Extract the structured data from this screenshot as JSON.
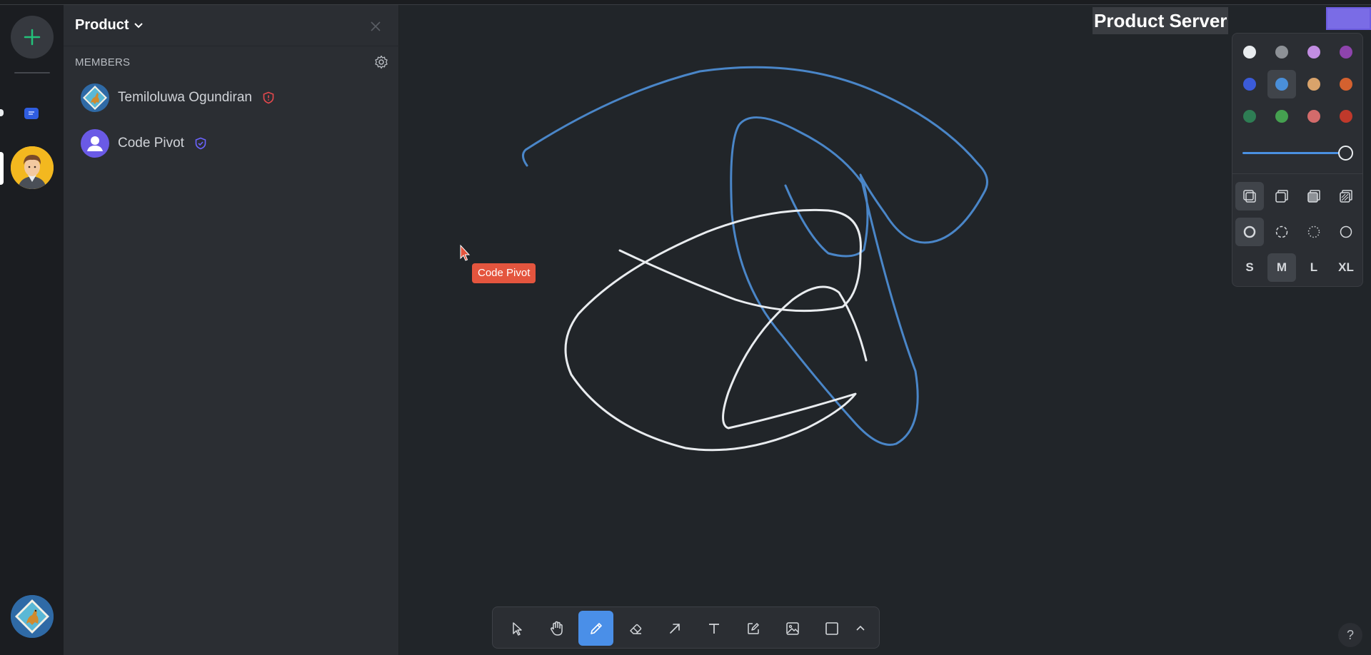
{
  "server": {
    "name": "Product",
    "members_heading": "MEMBERS",
    "members": [
      {
        "name": "Temiloluwa Ogundiran",
        "role_icon": "admin-shield-icon",
        "role_color": "#e5484d"
      },
      {
        "name": "Code Pivot",
        "role_icon": "moderator-shield-icon",
        "role_color": "#6b63ff"
      }
    ]
  },
  "canvas": {
    "server_label": "Product Server",
    "cursor_label": "Code Pivot",
    "stroke_colors": {
      "white": "#e9ecef",
      "blue": "#4a86c8"
    }
  },
  "style_panel": {
    "colors": [
      "#e9ecef",
      "#8d9196",
      "#c28de2",
      "#8e44ad",
      "#3b5bd9",
      "#4a8fd9",
      "#d9a36b",
      "#d4612f",
      "#2e7d54",
      "#45a050",
      "#d36b6b",
      "#c0392b"
    ],
    "selected_color_index": 5,
    "opacity_percent": 100,
    "sizes": [
      "S",
      "M",
      "L",
      "XL"
    ],
    "selected_size": "M"
  },
  "toolbar": {
    "tools": [
      "select-tool",
      "hand-tool",
      "draw-tool",
      "eraser-tool",
      "arrow-tool",
      "text-tool",
      "note-tool",
      "image-tool",
      "rectangle-tool",
      "more-tools"
    ],
    "active_tool": "draw-tool"
  },
  "help_label": "?"
}
